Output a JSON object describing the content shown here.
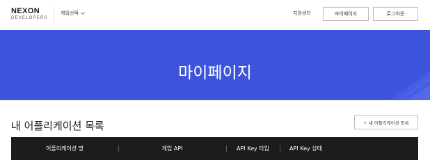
{
  "header": {
    "logo_main": "NEXON",
    "logo_sub": "DEVELOPERS",
    "game_select_label": "게임선택",
    "support_label": "지원센터",
    "mypage_label": "마이페이지",
    "login_label": "로그아웃"
  },
  "hero": {
    "title": "마이페이지",
    "background_color": "#3d55dd"
  },
  "section": {
    "title": "내 어플리케이션 목록",
    "register_label": "+ 새 어플리케이션 등록"
  },
  "table": {
    "columns": [
      "어플리케이션 명",
      "게임 API",
      "API Key 타입",
      "API Key 상태"
    ]
  },
  "icons": {
    "game_select_chevron": "chevron-down-icon"
  }
}
